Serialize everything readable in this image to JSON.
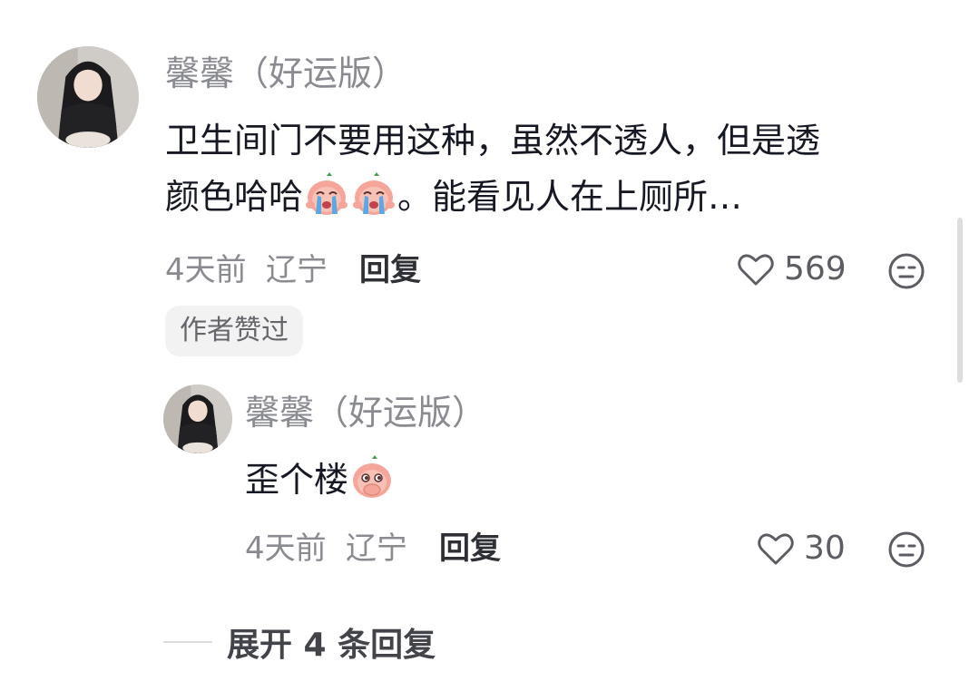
{
  "comment": {
    "author": "馨馨（好运版）",
    "text_line1": "卫生间门不要用这种，虽然不透人，但是透",
    "text_line2_a": "颜色哈哈",
    "text_line2_b": "。能看见人在上厕所…",
    "emojis": [
      "crying-peach-emoji",
      "crying-peach-emoji"
    ],
    "time": "4天前",
    "location": "辽宁",
    "reply_label": "回复",
    "likes": "569",
    "badge": "作者赞过"
  },
  "reply": {
    "author": "馨馨（好运版）",
    "text": "歪个楼",
    "emoji": "peach-covering-mouth-emoji",
    "time": "4天前",
    "location": "辽宁",
    "reply_label": "回复",
    "likes": "30"
  },
  "expand_label": "展开 4 条回复",
  "colors": {
    "secondary_text": "#8a8b91",
    "primary_text": "#161823",
    "badge_bg": "#f2f2f2"
  }
}
